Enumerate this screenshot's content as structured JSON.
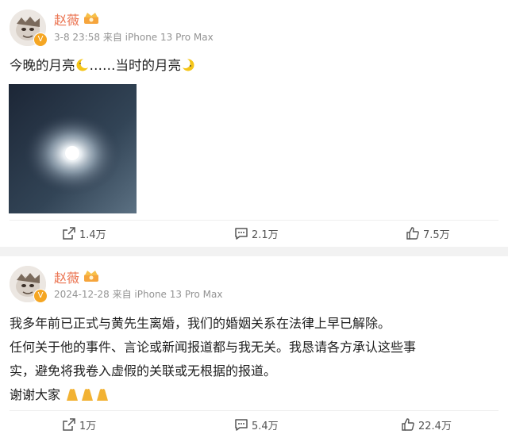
{
  "colors": {
    "username": "#eb7350",
    "meta": "#939393",
    "action": "#555555",
    "verify": "#f5a623"
  },
  "posts": [
    {
      "username": "赵薇",
      "time": "3-8 23:58",
      "source_prefix": "来自",
      "device": "iPhone 13 Pro Max",
      "text_lines": [
        "今晚的月亮",
        "……当时的月亮"
      ],
      "actions": {
        "repost": "1.4万",
        "comment": "2.1万",
        "like": "7.5万"
      }
    },
    {
      "username": "赵薇",
      "time": "2024-12-28",
      "source_prefix": "来自",
      "device": "iPhone 13 Pro Max",
      "text_lines": [
        "我多年前已正式与黄先生离婚，我们的婚姻关系在法律上早已解除。",
        "任何关于他的事件、言论或新闻报道都与我无关。我恳请各方承认这些事",
        "实，避免将我卷入虚假的关联或无根据的报道。",
        "谢谢大家"
      ],
      "actions": {
        "repost": "1万",
        "comment": "5.4万",
        "like": "22.4万"
      }
    }
  ],
  "icons": [
    "crown-icon",
    "verified-icon",
    "moon-icon",
    "pray-icon",
    "repost-icon",
    "comment-icon",
    "like-icon"
  ]
}
